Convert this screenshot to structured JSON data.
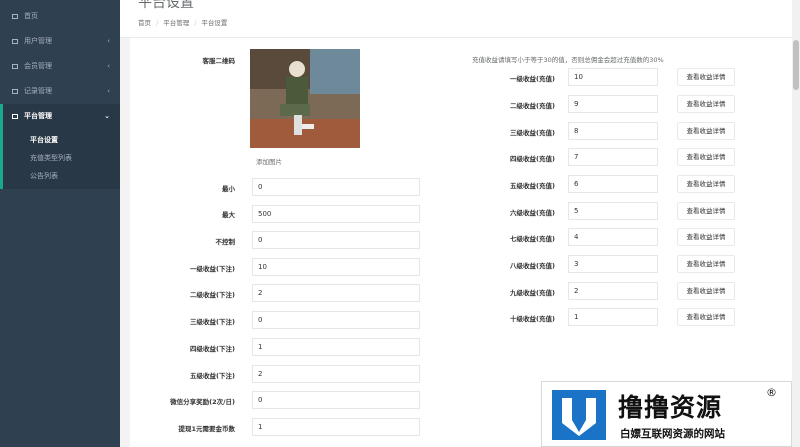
{
  "sidebar": {
    "items": [
      {
        "label": "首页",
        "has_chevron": false
      },
      {
        "label": "用户管理",
        "has_chevron": true
      },
      {
        "label": "会员管理",
        "has_chevron": true
      },
      {
        "label": "记录管理",
        "has_chevron": true
      },
      {
        "label": "平台管理",
        "has_chevron": true,
        "active": true
      }
    ],
    "sub_items": [
      "平台设置",
      "充值类型列表",
      "公告列表"
    ],
    "chevron": "‹",
    "chevron_open": "⌄"
  },
  "header": {
    "title": "平台设置",
    "breadcrumb": [
      "首页",
      "平台管理",
      "平台设置"
    ]
  },
  "form": {
    "qr_label": "客服二维码",
    "add_pic": "添加图片",
    "fields": [
      {
        "label": "最小",
        "value": "0"
      },
      {
        "label": "最大",
        "value": "500"
      },
      {
        "label": "不控制",
        "value": "0"
      },
      {
        "label": "一级收益(下注)",
        "value": "10"
      },
      {
        "label": "二级收益(下注)",
        "value": "2"
      },
      {
        "label": "三级收益(下注)",
        "value": "0"
      },
      {
        "label": "四级收益(下注)",
        "value": "1"
      },
      {
        "label": "五级收益(下注)",
        "value": "2"
      },
      {
        "label": "微信分享奖励(2次/日)",
        "value": "0"
      },
      {
        "label": "提现1元需要金币数",
        "value": "1"
      }
    ]
  },
  "recharge": {
    "hint": "充值收益请填写小于等于30的值，否则总佣金会超过充值数的30%",
    "button_label": "查看收益详情",
    "rows": [
      {
        "label": "一级收益(充值)",
        "value": "10"
      },
      {
        "label": "二级收益(充值)",
        "value": "9"
      },
      {
        "label": "三级收益(充值)",
        "value": "8"
      },
      {
        "label": "四级收益(充值)",
        "value": "7"
      },
      {
        "label": "五级收益(充值)",
        "value": "6"
      },
      {
        "label": "六级收益(充值)",
        "value": "5"
      },
      {
        "label": "七级收益(充值)",
        "value": "4"
      },
      {
        "label": "八级收益(充值)",
        "value": "3"
      },
      {
        "label": "九级收益(充值)",
        "value": "2"
      },
      {
        "label": "十级收益(充值)",
        "value": "1"
      }
    ]
  },
  "watermark": {
    "title": "撸撸资源",
    "subtitle": "白嫖互联网资源的网站",
    "reg": "®"
  },
  "colors": {
    "sidebar_bg": "#2f4050",
    "sidebar_active": "#293846",
    "accent": "#19aa8d",
    "watermark_blue": "#1b73c8"
  }
}
